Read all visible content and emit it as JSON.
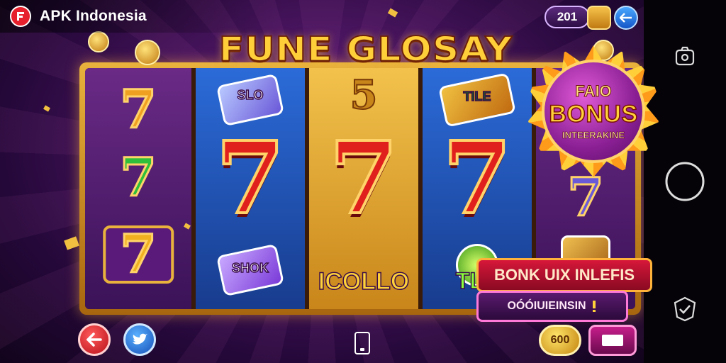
{
  "app": {
    "title": "APK Indonesia"
  },
  "hud": {
    "coins": "201"
  },
  "game": {
    "title": "FUNE GLOSAY"
  },
  "reels": {
    "reel0": [
      {
        "label": "7"
      },
      {
        "label": "7"
      },
      {
        "label": "7"
      }
    ],
    "reel1": [
      {
        "label": "SLO"
      },
      {
        "label": "7"
      },
      {
        "label": "SHOK"
      }
    ],
    "reel2": [
      {
        "label": "5"
      },
      {
        "label": "7"
      },
      {
        "label": "ICOLLO"
      }
    ],
    "reel3": [
      {
        "label": "TILE"
      },
      {
        "label": "7"
      },
      {
        "label": "TLE"
      }
    ],
    "reel4": [
      {
        "label": "7"
      }
    ]
  },
  "bonus": {
    "top": "FAIO",
    "main": "BONUS",
    "sub": "INTEERAKINE"
  },
  "promo": {
    "line1": "BONK UIX INLEFIS",
    "line2": "OÓÓIUIEINSIN"
  },
  "bottom": {
    "gold_label": "600"
  },
  "colors": {
    "accent": "#ffcf3a",
    "reel_blue": "#2b6bd8",
    "reel_gold": "#f2c24c",
    "reel_purple": "#6a2a86"
  }
}
